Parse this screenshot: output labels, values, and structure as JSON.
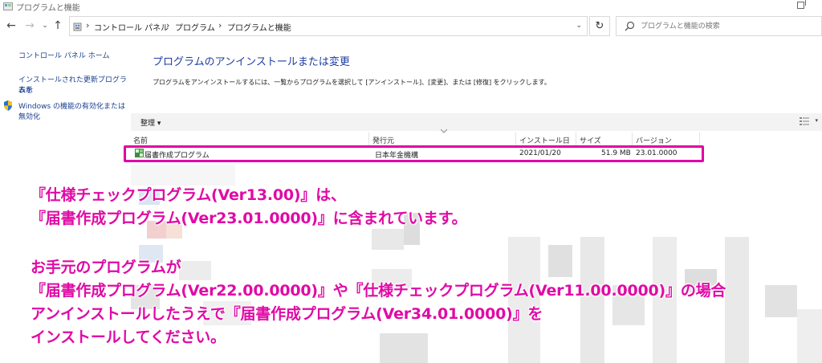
{
  "window": {
    "title": "プログラムと機能"
  },
  "address": {
    "breadcrumbs": [
      "コントロール パネル",
      "プログラム",
      "プログラムと機能"
    ]
  },
  "search": {
    "placeholder": "プログラムと機能の検索"
  },
  "sidebar": {
    "links": [
      {
        "label": "コントロール パネル ホーム"
      },
      {
        "label_line1": "インストールされた更新プログラムを",
        "label_line2": "表示"
      },
      {
        "label_line1": "Windows の機能の有効化または",
        "label_line2": "無効化"
      }
    ]
  },
  "main": {
    "heading": "プログラムのアンインストールまたは変更",
    "instruction": "プログラムをアンインストールするには、一覧からプログラムを選択して [アンインストール]、[変更]、または [修復] をクリックします。",
    "toolbar": {
      "organize_label": "整理 ▾"
    },
    "columns": [
      "名前",
      "発行元",
      "インストール日",
      "サイズ",
      "バージョン"
    ],
    "rows": [
      {
        "name": "届書作成プログラム",
        "publisher": "日本年金機構",
        "installed": "2021/01/20",
        "size": "51.9 MB",
        "version": "23.01.0000"
      }
    ]
  },
  "annotation": {
    "lines": [
      "『仕様チェックプログラム(Ver13.00)』は、",
      "『届書作成プログラム(Ver23.01.0000)』に含まれています。",
      "お手元のプログラムが",
      "『届書作成プログラム(Ver22.00.0000)』や『仕様チェックプログラム(Ver11.00.0000)』の場合",
      "アンインストールしたうえで『届書作成プログラム(Ver34.01.0000)』を",
      "インストールしてください。"
    ]
  },
  "colors": {
    "annotation": "#e00aa5",
    "highlight_border": "#e100a6",
    "heading": "#1e3ea0",
    "link": "#1a3f8f"
  },
  "icons": [
    "back-arrow-icon",
    "forward-arrow-icon",
    "up-arrow-icon",
    "refresh-icon",
    "search-icon",
    "shield-icon",
    "program-icon"
  ]
}
